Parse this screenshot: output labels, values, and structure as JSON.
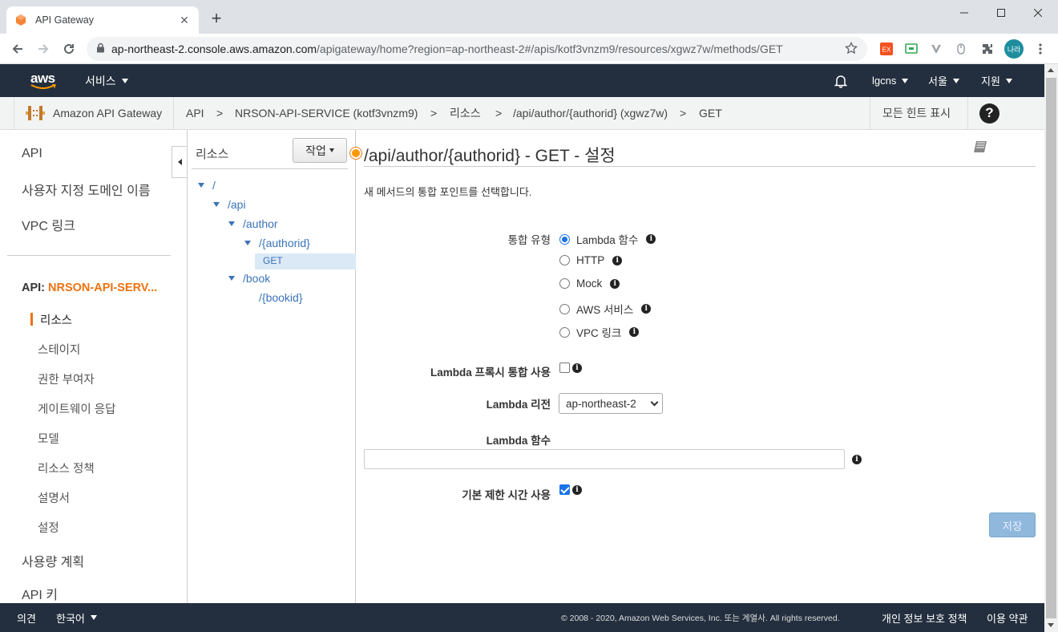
{
  "browser": {
    "tab_title": "API Gateway",
    "url_host": "ap-northeast-2.console.aws.amazon.com",
    "url_path": "/apigateway/home?region=ap-northeast-2#/apis/kotf3vnzm9/resources/xgwz7w/methods/GET",
    "profile_initials": "나라"
  },
  "aws_nav": {
    "logo": "aws",
    "services": "서비스",
    "account": "lgcns",
    "region": "서울",
    "support": "지원"
  },
  "breadcrumb": {
    "service": "Amazon API Gateway",
    "items": [
      "API",
      "NRSON-API-SERVICE (kotf3vnzm9)",
      "리소스",
      "/api/author/{authorid} (xgwz7w)",
      "GET"
    ],
    "separator": ">",
    "hints": "모든 힌트 표시",
    "help": "?"
  },
  "left_nav": {
    "items": [
      "API",
      "사용자 지정 도메인 이름",
      "VPC 링크"
    ],
    "api_prefix": "API:",
    "api_name": "NRSON-API-SERV...",
    "sub_items": [
      "리소스",
      "스테이지",
      "권한 부여자",
      "게이트웨이 응답",
      "모델",
      "리소스 정책",
      "설명서",
      "설정"
    ],
    "bottom_items": [
      "사용량 계획",
      "API 키"
    ]
  },
  "tree": {
    "title": "리소스",
    "actions": "작업",
    "nodes": [
      "/",
      "/api",
      "/author",
      "/{authorid}",
      "GET",
      "/book",
      "/{bookid}"
    ]
  },
  "main": {
    "title": "/api/author/{authorid} - GET - 설정",
    "description": "새 메서드의 통합 포인트를 선택합니다.",
    "integration_type_label": "통합 유형",
    "integration_options": [
      "Lambda 함수",
      "HTTP",
      "Mock",
      "AWS 서비스",
      "VPC 링크"
    ],
    "selected_integration": "Lambda 함수",
    "proxy_label": "Lambda 프록시 통합 사용",
    "proxy_checked": false,
    "region_label": "Lambda 리전",
    "region_value": "ap-northeast-2",
    "function_label": "Lambda 함수",
    "function_value": "",
    "timeout_label": "기본 제한 시간 사용",
    "timeout_checked": true,
    "save": "저장"
  },
  "footer": {
    "feedback": "의견",
    "language": "한국어",
    "copyright": "© 2008 - 2020, Amazon Web Services, Inc. 또는 계열사. All rights reserved.",
    "privacy": "개인 정보 보호 정책",
    "terms": "이용 약관"
  },
  "colors": {
    "aws_dark": "#232f3e",
    "aws_orange": "#ec7211",
    "link_blue": "#3b73b9"
  }
}
